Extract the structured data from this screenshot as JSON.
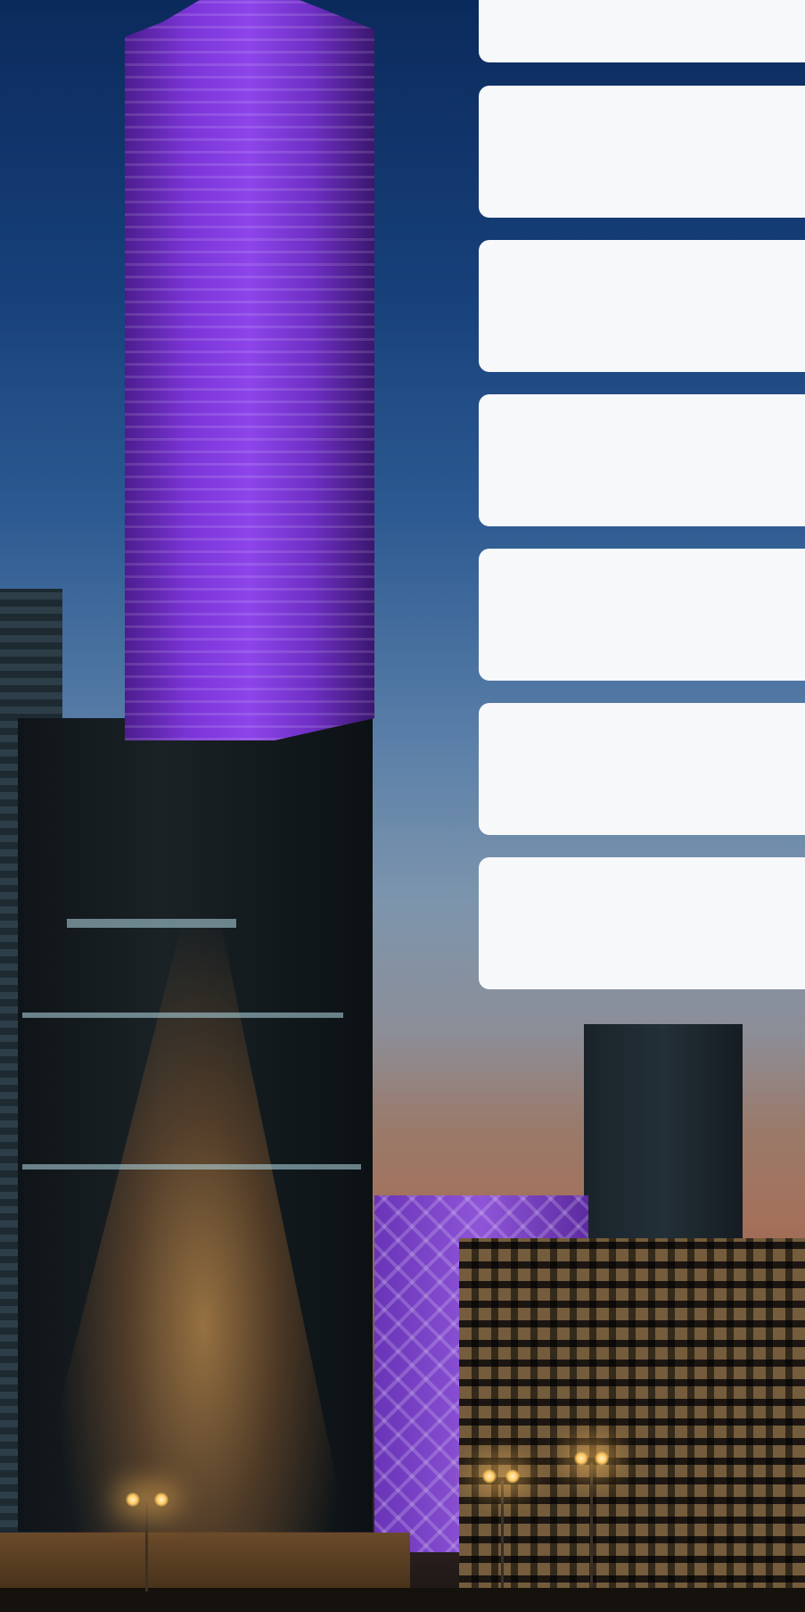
{
  "background": {
    "description_icon": "city-skyline-photo"
  },
  "cards": [
    {
      "label": ""
    },
    {
      "label": ""
    },
    {
      "label": ""
    },
    {
      "label": ""
    },
    {
      "label": ""
    },
    {
      "label": ""
    },
    {
      "label": ""
    }
  ]
}
